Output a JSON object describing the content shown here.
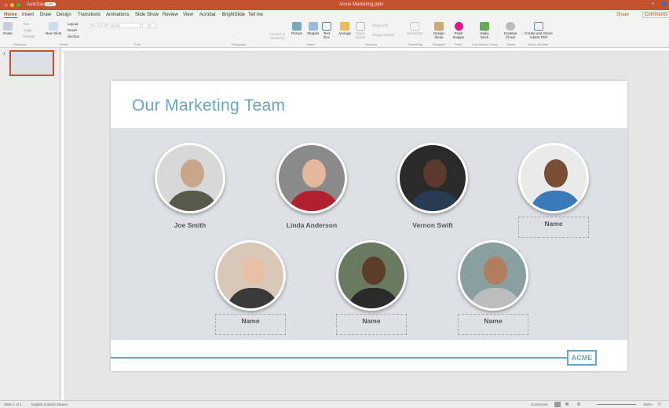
{
  "window": {
    "autosave_label": "AutoSave",
    "autosave_state": "OFF",
    "title": "Acme Marketing.pptx"
  },
  "tabs": [
    "Home",
    "Insert",
    "Draw",
    "Design",
    "Transitions",
    "Animations",
    "Slide Show",
    "Review",
    "View",
    "Acrobat",
    "BrightSlide",
    "Tell me"
  ],
  "actions": {
    "share": "Share",
    "comments": "Comments"
  },
  "ribbon": {
    "buttons": [
      "Paste",
      "Cut",
      "Copy",
      "Format",
      "New Slide",
      "Layout",
      "Reset",
      "Section",
      "Convert to SmartArt",
      "Picture",
      "Shapes",
      "Text Box",
      "Arrange",
      "Quick Styles",
      "Shape Fill",
      "Shape Outline",
      "Sensitivity",
      "Design Ideas",
      "Pickit Images",
      "Haiku Deck",
      "Creative Cloud",
      "Create and Share Adobe PDF"
    ],
    "font_name": "Tw Cen MT (Body)",
    "font_size": "20",
    "groups": [
      "Clipboard",
      "Slides",
      "Font",
      "Paragraph",
      "Insert",
      "Drawing",
      "Sensitivity",
      "Designer",
      "Pickit",
      "Commands Group",
      "Adobe",
      "Adobe Acrobat"
    ]
  },
  "thumbnail": {
    "number": "1"
  },
  "slide": {
    "title": "Our Marketing Team",
    "logo": "ACME",
    "people": [
      {
        "name": "Joe Smith",
        "skin": "#c9a58a",
        "shirt": "#5a5a4a",
        "bg": "#d8d8d8"
      },
      {
        "name": "Linda Anderson",
        "skin": "#e5b79c",
        "shirt": "#b3202d",
        "bg": "#8a8a8a"
      },
      {
        "name": "Vernon Swift",
        "skin": "#5a3a2a",
        "shirt": "#2a3a55",
        "bg": "#2a2a2a"
      },
      {
        "name": "Name",
        "skin": "#7a4e34",
        "shirt": "#3a7ab8",
        "bg": "#eaeaea"
      },
      {
        "name": "Name",
        "skin": "#e8c0a5",
        "shirt": "#3a3a3a",
        "bg": "#d8c8b8"
      },
      {
        "name": "Name",
        "skin": "#5e3c2a",
        "shirt": "#2a2a2a",
        "bg": "#6a7a60"
      },
      {
        "name": "Name",
        "skin": "#b07e5e",
        "shirt": "#bdbdbd",
        "bg": "#8aa0a0"
      }
    ]
  },
  "status": {
    "slide": "Slide 1 of 1",
    "language": "English (United States)",
    "comments": "Comments",
    "zoom": "160%"
  },
  "colors": {
    "titlebar": "#c4522f",
    "accent": "#6aa5c2"
  }
}
